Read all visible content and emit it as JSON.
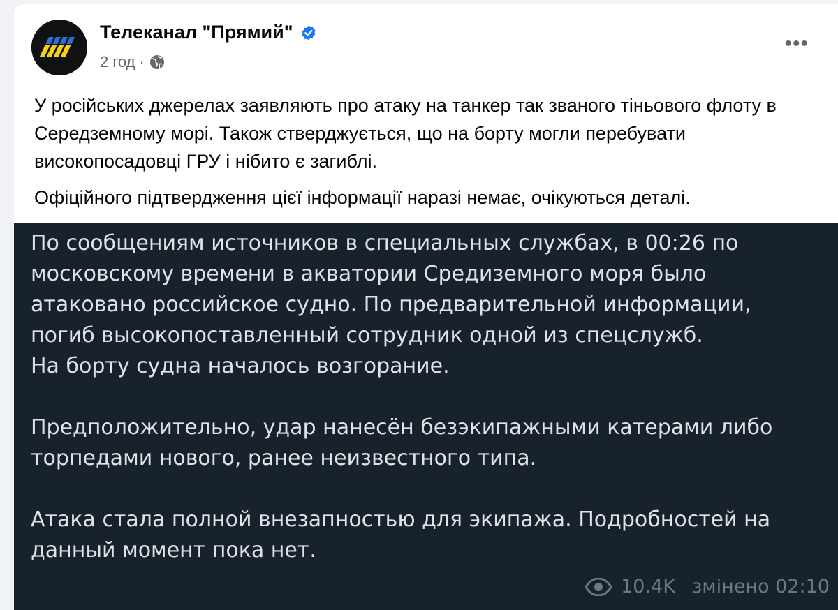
{
  "post": {
    "author": "Телеканал \"Прямий\"",
    "time": "2 год",
    "separator": "·",
    "more_label": "•••",
    "paragraphs": [
      "У російських джерелах заявляють про атаку на танкер так званого тіньового флоту в Середземному морі. Також стверджується, що на борту могли перебувати високопосадовці ГРУ і нібито є загиблі.",
      "Офіційного підтвердження цієї інформації наразі немає, очікуються деталі."
    ]
  },
  "image": {
    "paragraphs": [
      "По сообщениям источников в специальных службах, в 00:26 по московскому времени в акватории Средиземного моря было атаковано российское судно. По предварительной информации, погиб высокопоставленный сотрудник одной из спецслужб.\nНа борту судна началось возгорание.",
      "Предположительно, удар нанесён безэкипажными катерами либо торпедами нового, ранее неизвестного типа.",
      "Атака стала полной внезапностью для экипажа. Подробностей на данный момент пока нет."
    ],
    "views": "10.4K",
    "edited": "змінено 02:10"
  },
  "colors": {
    "verified": "#1877f2",
    "image_bg": "#18222d",
    "logo_yellow": "#f7d117",
    "logo_blue": "#2d6fd8"
  },
  "icons": [
    "avatar-logo",
    "verified-badge-icon",
    "globe-icon",
    "more-icon",
    "eye-icon"
  ]
}
